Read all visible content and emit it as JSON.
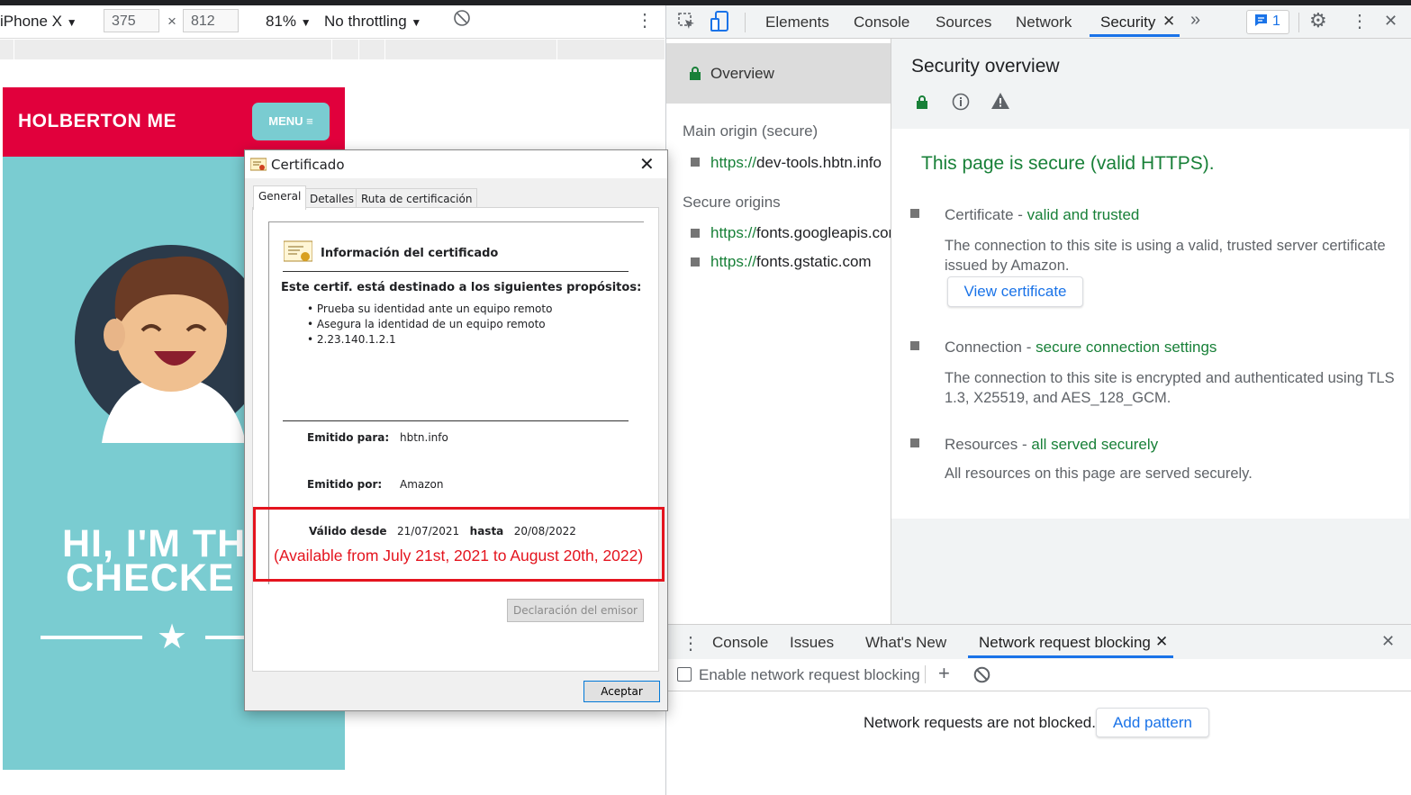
{
  "device_toolbar": {
    "device": "iPhone X",
    "width": "375",
    "height": "812",
    "times": "×",
    "zoom": "81%",
    "throttling": "No throttling"
  },
  "phone_page": {
    "brand": "HOLBERTON ME",
    "menu": "MENU",
    "hero_line1": "HI, I'M TH",
    "hero_line2": "CHECKE"
  },
  "devtools": {
    "tabs": [
      "Elements",
      "Console",
      "Sources",
      "Network",
      "Security"
    ],
    "issues_count": "1",
    "sidebar": {
      "overview": "Overview",
      "main_origin_heading": "Main origin (secure)",
      "main_origin": {
        "scheme": "https://",
        "host": "dev-tools.hbtn.info"
      },
      "secure_origins_heading": "Secure origins",
      "secure_origins": [
        {
          "scheme": "https://",
          "host": "fonts.googleapis.com"
        },
        {
          "scheme": "https://",
          "host": "fonts.gstatic.com"
        }
      ]
    },
    "overview": {
      "title": "Security overview",
      "secure_message": "This page is secure (valid HTTPS).",
      "certificate_label": "Certificate - ",
      "certificate_status": "valid and trusted",
      "certificate_desc": "The connection to this site is using a valid, trusted server certificate issued by Amazon.",
      "view_certificate": "View certificate",
      "connection_label": "Connection - ",
      "connection_status": "secure connection settings",
      "connection_desc": "The connection to this site is encrypted and authenticated using TLS 1.3, X25519, and AES_128_GCM.",
      "resources_label": "Resources - ",
      "resources_status": "all served securely",
      "resources_desc": "All resources on this page are served securely."
    },
    "drawer": {
      "tabs": [
        "Console",
        "Issues",
        "What's New",
        "Network request blocking"
      ],
      "enable_label": "Enable network request blocking",
      "not_blocked": "Network requests are not blocked.",
      "add_pattern": "Add pattern"
    },
    "colors": {
      "accent": "#1a73e8",
      "secure_green": "#188038",
      "brand_red": "#e1003c",
      "teal": "#7accd1",
      "annotation_red": "#e4141e"
    }
  },
  "certificate_dialog": {
    "title": "Certificado",
    "tabs": [
      "General",
      "Detalles",
      "Ruta de certificación"
    ],
    "info_heading": "Información del certificado",
    "purposes_heading": "Este certif. está destinado a los siguientes propósitos:",
    "purposes": [
      "• Prueba su identidad ante un equipo remoto",
      "• Asegura la identidad de un equipo remoto",
      "• 2.23.140.1.2.1"
    ],
    "issued_to_label": "Emitido para:",
    "issued_to": "hbtn.info",
    "issued_by_label": "Emitido por:",
    "issued_by": "Amazon",
    "valid_from_label": "Válido desde",
    "valid_from": "21/07/2021",
    "valid_to_label": "hasta",
    "valid_to": "20/08/2022",
    "annotation": "(Available from July 21st, 2021 to August 20th, 2022)",
    "issuer_statement": "Declaración del emisor",
    "ok": "Aceptar"
  }
}
